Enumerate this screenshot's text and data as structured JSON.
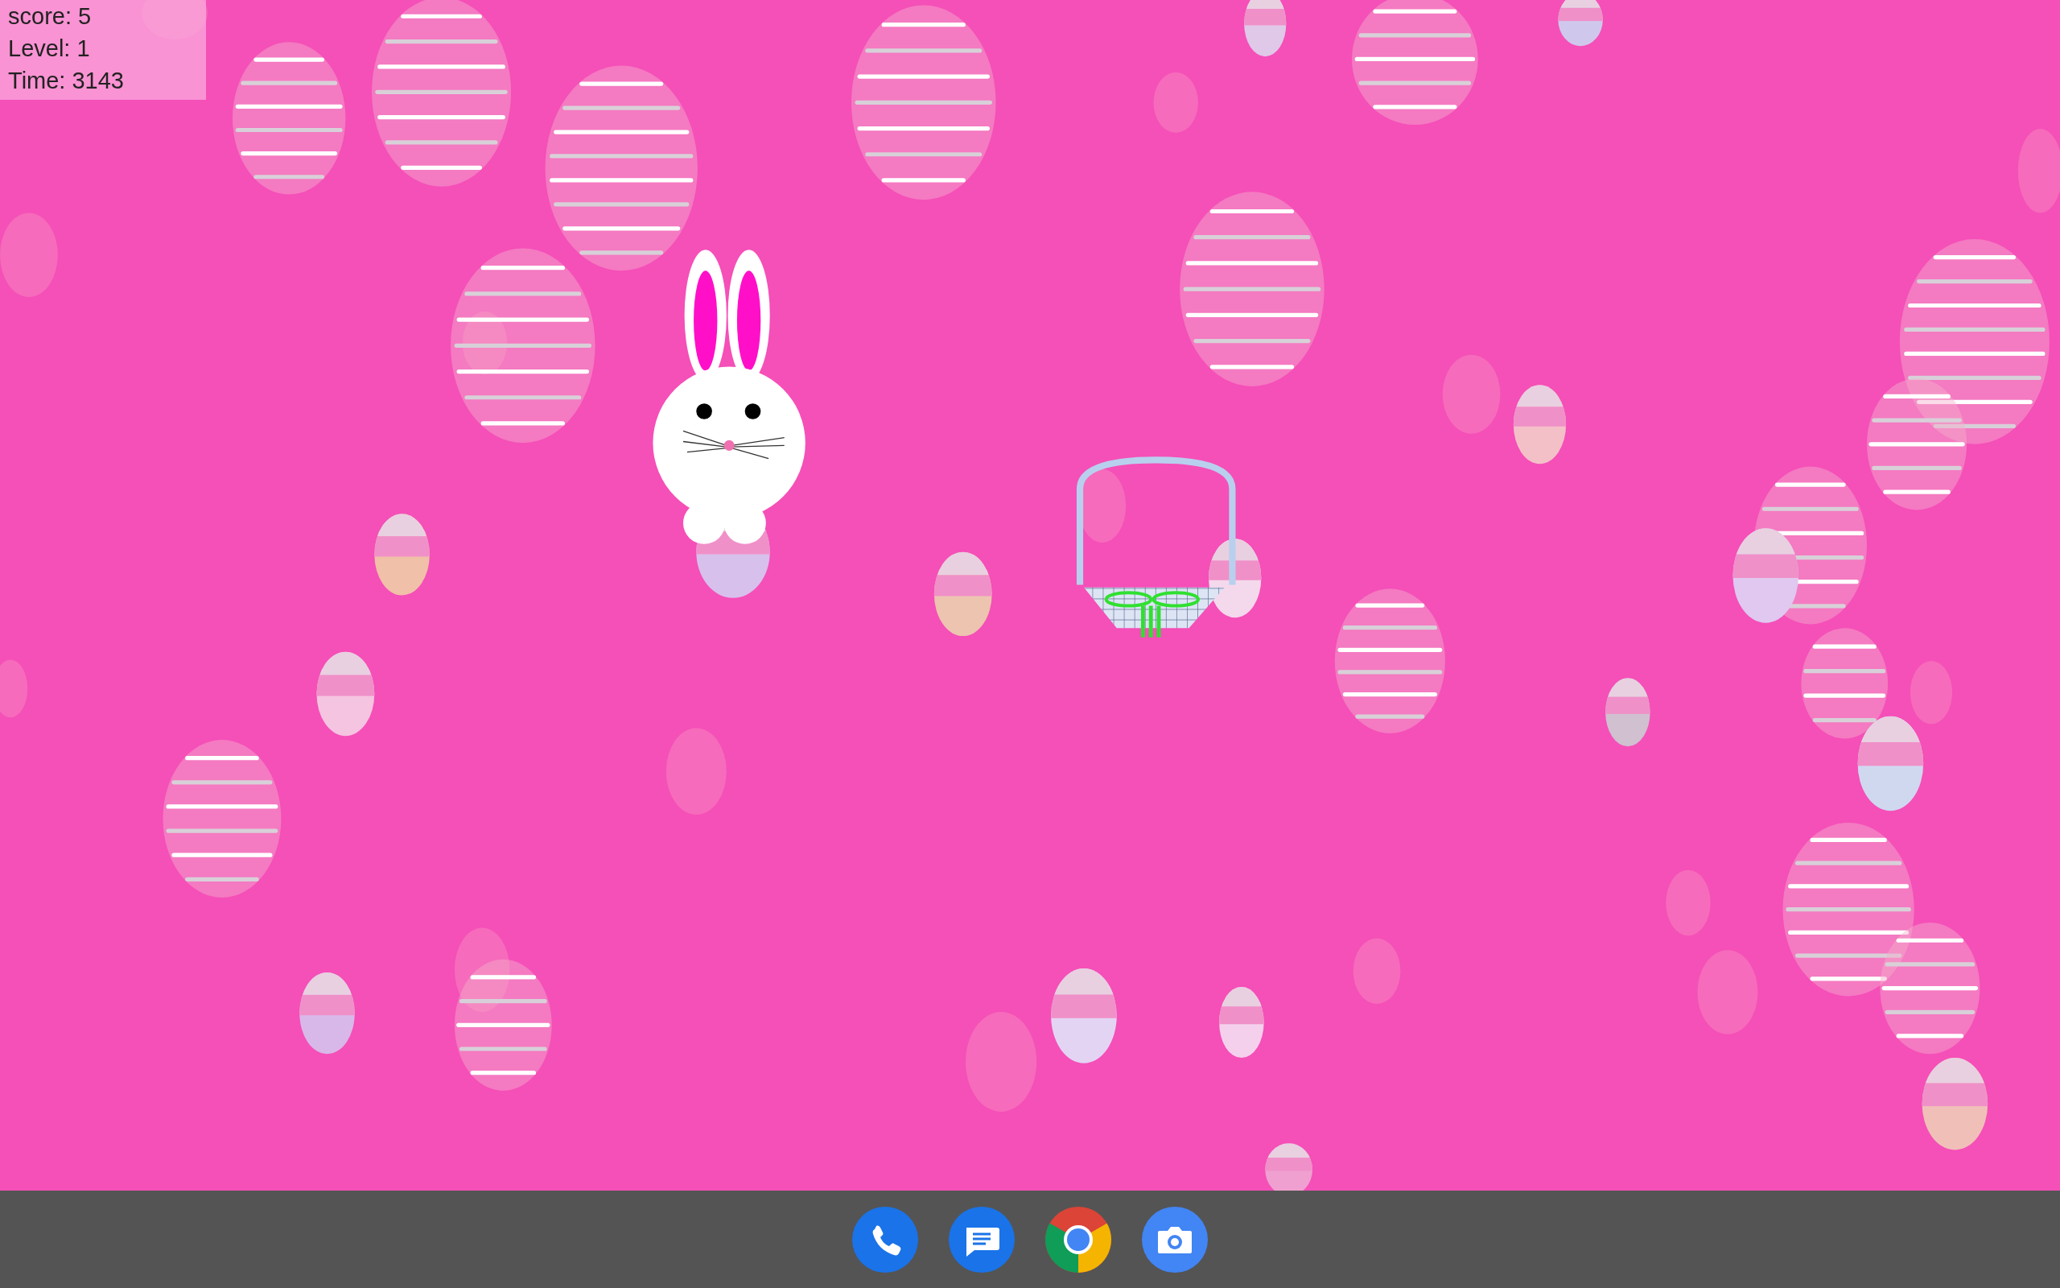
{
  "hud": {
    "lines": [
      "score: 5",
      "Level: 1",
      "Time: 3143"
    ]
  },
  "dock": {
    "apps": [
      {
        "kind": "phone"
      },
      {
        "kind": "messages"
      },
      {
        "kind": "browser"
      },
      {
        "kind": "camera"
      }
    ]
  }
}
